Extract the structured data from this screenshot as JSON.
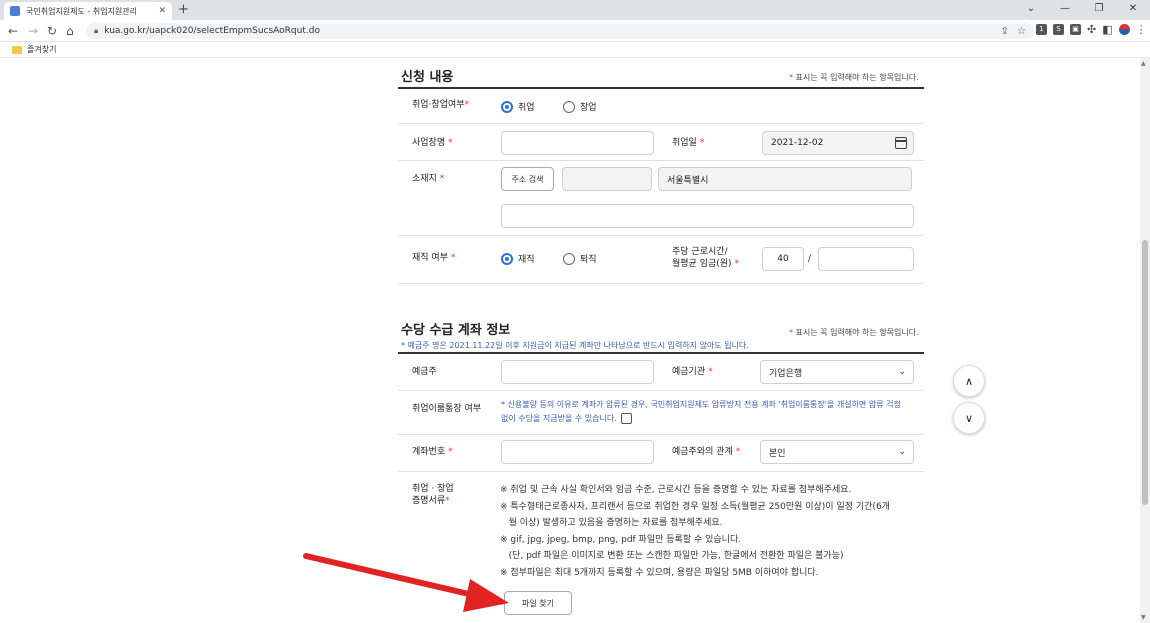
{
  "browser": {
    "tab_title": "국민취업지원제도 - 취업지원관리",
    "url": "kua.go.kr/uapck020/selectEmpmSucsAoRqut.do",
    "bookmark": "즐겨찾기"
  },
  "section1": {
    "title": "신청 내용",
    "req_note": "표시는 꼭 입력해야 하는 항목입니다.",
    "job_type_label": "취업·창업여부",
    "opt_employed": "취업",
    "opt_startup": "창업",
    "company_label": "사업장명",
    "company_value": "",
    "hire_date_label": "취업일",
    "hire_date_value": "2021-12-02",
    "address_label": "소재지",
    "address_search_btn": "주소 검색",
    "postcode_value": "",
    "city_value": "서울특별시",
    "address_detail_value": "",
    "work_status_label": "재직 여부",
    "opt_working": "재직",
    "opt_resigned": "퇴직",
    "hours_label_1": "주당 근로시간/",
    "hours_label_2": "월평균 임금(원)",
    "hours_value": "40",
    "hours_sep": "/",
    "wage_value": ""
  },
  "section2": {
    "title": "수당 수급 계좌 정보",
    "req_note": "표시는 꼭 입력해야 하는 항목입니다.",
    "depositor_note": "* 예금주 명은 2021.11.22일 이후 지원금이 지급된 계좌만 나타남으로 반드시 입력하지 않아도 됩니다.",
    "depositor_label": "예금주",
    "depositor_value": "",
    "bank_label": "예금기관",
    "bank_value": "기업은행",
    "exclusive_label": "취업이룸통장 여부",
    "exclusive_note_1": "* 신용불량 등의 이유로 계좌가 압류된 경우, 국민취업지원제도 압류방지 전용 계좌 '취업이룸통장'을 개설하면 압류 걱정",
    "exclusive_note_2": "없이 수당을 지급받을 수 있습니다.",
    "account_label": "계좌번호",
    "account_value": "",
    "relation_label": "예금주와의 관계",
    "relation_value": "본인",
    "doc_label_1": "취업 · 창업",
    "doc_label_2": "증명서류",
    "doc_notes": [
      "※ 취업 및 근속 사실 확인서와 임금 수준, 근로시간 등을 증명할 수 있는 자료를 첨부해주세요.",
      "※ 특수형태근로종사자, 프리랜서 등으로 취업한 경우 일정 소득(월평균 250만원 이상)이 일정 기간(6개",
      "   월 이상) 발생하고 있음을 증명하는 자료를 첨부해주세요.",
      "※ gif, jpg, jpeg, bmp, png, pdf 파일만 등록할 수 있습니다.",
      "   (단, pdf 파일은 이미지로 변환 또는 스캔한 파일만 가능, 한글에서 전환한 파일은 불가능)",
      "※ 첨부파일은 최대 5개까지 등록할 수 있으며, 용량은 파일당 5MB 이하여야 합니다."
    ],
    "file_button": "파일 찾기"
  },
  "icons": {
    "star": "*",
    "up": "∧",
    "down": "∨"
  },
  "colors": {
    "required": "#e23a2a",
    "radio_on": "#2b6fd6",
    "note_blue": "#3a5db8",
    "annotation_arrow": "#e02424"
  }
}
